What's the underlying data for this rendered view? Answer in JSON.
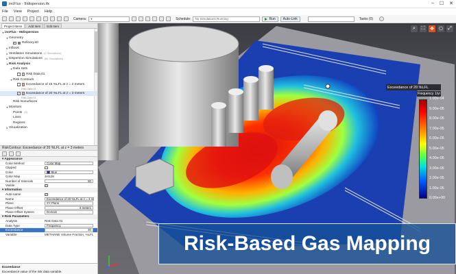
{
  "window": {
    "title": "incFlux - 9Idispersion.ifx"
  },
  "menu": [
    "File",
    "View",
    "Project",
    "Help"
  ],
  "toolbar": {
    "camera_label": "Camera:",
    "schedule_label": "Schedule:",
    "schedule_value": "No Simulations Running",
    "run_label": "Run",
    "autolink_label": "Auto-Link",
    "tasks_label": "Tasks (0)"
  },
  "left": {
    "tabs": [
      "Project Items",
      "Add Item",
      "Edit Item"
    ],
    "tree": [
      {
        "label": "incFlux - 9Idispersion",
        "indent": 0,
        "arrow": "◢",
        "bold": true
      },
      {
        "label": "Geometry",
        "indent": 1,
        "arrow": "◢"
      },
      {
        "label": "Refinery.stl",
        "indent": 2,
        "check": true,
        "swatch": "#888888"
      },
      {
        "label": "Inflows",
        "indent": 1,
        "arrow": "▷"
      },
      {
        "label": "Ventilation Simulations",
        "indent": 1,
        "arrow": "▷",
        "dim": "(0 Simulations)"
      },
      {
        "label": "Dispersion Simulations",
        "indent": 1,
        "arrow": "▷",
        "dim": "(80 Simulations)"
      },
      {
        "label": "Risk Analysis",
        "indent": 1,
        "arrow": "◢",
        "bold": true
      },
      {
        "label": "Data Sets",
        "indent": 2,
        "arrow": "◢"
      },
      {
        "label": "Risk Data 01",
        "indent": 3,
        "check": false,
        "swatch": "#cccccc"
      },
      {
        "label": "Risk Contours",
        "indent": 2,
        "arrow": "◢"
      },
      {
        "label": "Exceedance of 15 %LFL at z = 2 meters",
        "indent": 3,
        "check": false,
        "swatch": "#e8a0a0"
      },
      {
        "label": "Risk Data 01",
        "indent": 4,
        "sub": true
      },
      {
        "label": "Exceedance of 20 %LFL at z = 3 meters",
        "indent": 3,
        "check": true,
        "swatch": "#e8a0a0",
        "selected": true
      },
      {
        "label": "Risk Data 01",
        "indent": 4,
        "sub": true
      },
      {
        "label": "Risk Isosurfaces",
        "indent": 2
      },
      {
        "label": "Monitors",
        "indent": 1,
        "arrow": "◢"
      },
      {
        "label": "Points",
        "indent": 2,
        "dim": "(0)"
      },
      {
        "label": "Lines",
        "indent": 2
      },
      {
        "label": "Regions",
        "indent": 2
      },
      {
        "label": "Visualization",
        "indent": 1,
        "arrow": "▷"
      }
    ],
    "properties_title": "RiskContour: Exceedance of 20 %LFL at z = 3 meters",
    "properties": [
      {
        "type": "cat",
        "name": "Appearance"
      },
      {
        "name": "Color Method",
        "value": "Color Map",
        "box": true
      },
      {
        "name": "Clipped",
        "check": false
      },
      {
        "name": "Color",
        "value": "Blue",
        "swatch": "#1a33cc",
        "box": true
      },
      {
        "name": "Color Map",
        "value": "Jet128"
      },
      {
        "name": "Number of Intervals",
        "value": "50",
        "box": true,
        "right": true
      },
      {
        "name": "Visible",
        "check": true
      },
      {
        "type": "cat",
        "name": "Information"
      },
      {
        "name": "Auto-name",
        "check": true
      },
      {
        "name": "Name",
        "value": "Exceedance of 20 %LFL at z = 3 m",
        "box": true
      },
      {
        "name": "Plane",
        "value": "XY Plane",
        "box": true
      },
      {
        "name": "Plane Offset",
        "value": "3 meters",
        "box": true,
        "right": true
      },
      {
        "name": "Plane Offset System",
        "value": "Domain",
        "box": true
      },
      {
        "type": "cat",
        "name": "Risk Parameters"
      },
      {
        "name": "Analysis",
        "value": "Risk Data 01"
      },
      {
        "name": "Data Type",
        "value": "Frequency",
        "box": true
      },
      {
        "name": "Exceedance",
        "value": "20",
        "box": true,
        "right": true,
        "selected": true
      },
      {
        "name": "Variable",
        "value": "METHANE Volume Fraction, %LFL"
      }
    ],
    "description": {
      "title": "Exceedance",
      "text": "Exceedance value of the risk data variable."
    }
  },
  "viewport": {
    "legend_title": "Exceedance of 20 %LFL",
    "legend_subtitle": "Frequency  1/yr",
    "legend_ticks": [
      "1.00e-04",
      "9.00e-05",
      "8.00e-05",
      "7.00e-05",
      "6.00e-05",
      "5.00e-05",
      "4.00e-05",
      "3.00e-05",
      "2.00e-05",
      "1.00e-05",
      "0.00e+00"
    ],
    "banner": "Risk-Based Gas Mapping",
    "tool_icons": [
      "zoom-icon",
      "fit-icon",
      "pan-icon",
      "camera-icon",
      "fullscreen-icon"
    ]
  },
  "colors": {
    "accent": "#1650a0",
    "hot": "#ff0000",
    "selection": "#3875c9"
  }
}
